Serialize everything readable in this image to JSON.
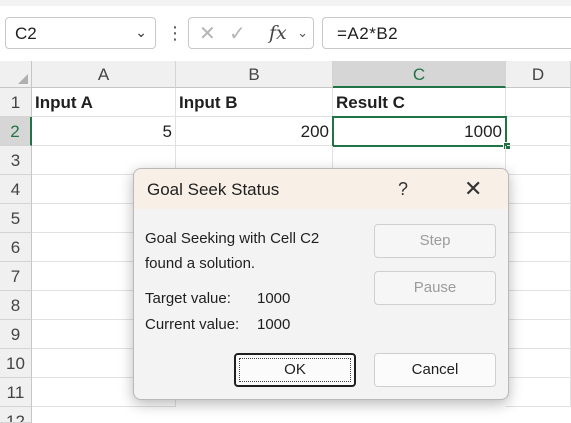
{
  "formula_bar": {
    "name_box": "C2",
    "more_icon": "⋮",
    "cancel_icon": "✕",
    "enter_icon": "✓",
    "fx_label": "fx",
    "formula": "=A2*B2"
  },
  "sheet": {
    "columns": [
      "A",
      "B",
      "C",
      "D"
    ],
    "rows": [
      "1",
      "2",
      "3",
      "4",
      "5",
      "6",
      "7",
      "8",
      "9",
      "10",
      "11",
      "12"
    ],
    "cells": {
      "A1": "Input A",
      "B1": "Input B",
      "C1": "Result C",
      "A2": "5",
      "B2": "200",
      "C2": "1000"
    },
    "selected_cell": "C2",
    "accent_color": "#217346"
  },
  "dialog": {
    "title": "Goal Seek Status",
    "help_label": "?",
    "close_label": "✕",
    "message_line1": "Goal Seeking with Cell C2",
    "message_line2": "found a solution.",
    "target_label": "Target value:",
    "target_value": "1000",
    "current_label": "Current value:",
    "current_value": "1000",
    "step_label": "Step",
    "pause_label": "Pause",
    "ok_label": "OK",
    "cancel_label": "Cancel"
  }
}
